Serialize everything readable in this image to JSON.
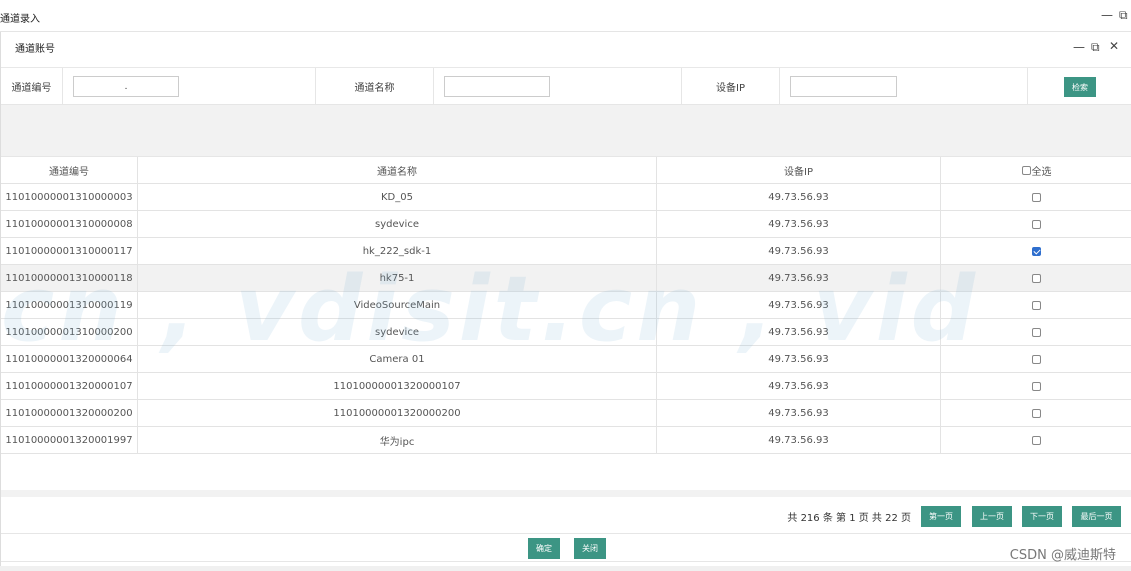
{
  "outer_window": {
    "title": "通道录入"
  },
  "dialog": {
    "title": "通道账号"
  },
  "search": {
    "channel_no_label": "通道编号",
    "channel_no_value": ".",
    "channel_name_label": "通道名称",
    "channel_name_value": "",
    "device_ip_label": "设备IP",
    "device_ip_value": "",
    "search_button": "检索"
  },
  "table": {
    "headers": [
      "通道编号",
      "通道名称",
      "设备IP",
      "全选"
    ],
    "rows": [
      {
        "code": "11010000001310000003",
        "name": "KD_05",
        "ip": "49.73.56.93",
        "checked": false
      },
      {
        "code": "11010000001310000008",
        "name": "sydevice",
        "ip": "49.73.56.93",
        "checked": false
      },
      {
        "code": "11010000001310000117",
        "name": "hk_222_sdk-1",
        "ip": "49.73.56.93",
        "checked": true
      },
      {
        "code": "11010000001310000118",
        "name": "hk75-1",
        "ip": "49.73.56.93",
        "checked": false
      },
      {
        "code": "11010000001310000119",
        "name": "VideoSourceMain",
        "ip": "49.73.56.93",
        "checked": false
      },
      {
        "code": "11010000001310000200",
        "name": "sydevice",
        "ip": "49.73.56.93",
        "checked": false
      },
      {
        "code": "11010000001320000064",
        "name": "Camera 01",
        "ip": "49.73.56.93",
        "checked": false
      },
      {
        "code": "11010000001320000107",
        "name": "11010000001320000107",
        "ip": "49.73.56.93",
        "checked": false
      },
      {
        "code": "11010000001320000200",
        "name": "11010000001320000200",
        "ip": "49.73.56.93",
        "checked": false
      },
      {
        "code": "11010000001320001997",
        "name": "华为ipc",
        "ip": "49.73.56.93",
        "checked": false
      }
    ]
  },
  "pager": {
    "info": "共 216 条 第 1 页  共 22 页",
    "first": "第一页",
    "prev": "上一页",
    "next": "下一页",
    "last": "最后一页"
  },
  "footer": {
    "confirm": "确定",
    "close": "关闭"
  },
  "watermark": "cn , vdisit.cn , vid",
  "credit": "CSDN @威迪斯特",
  "colors": {
    "accent": "#3c9584",
    "check": "#2f6fce"
  }
}
